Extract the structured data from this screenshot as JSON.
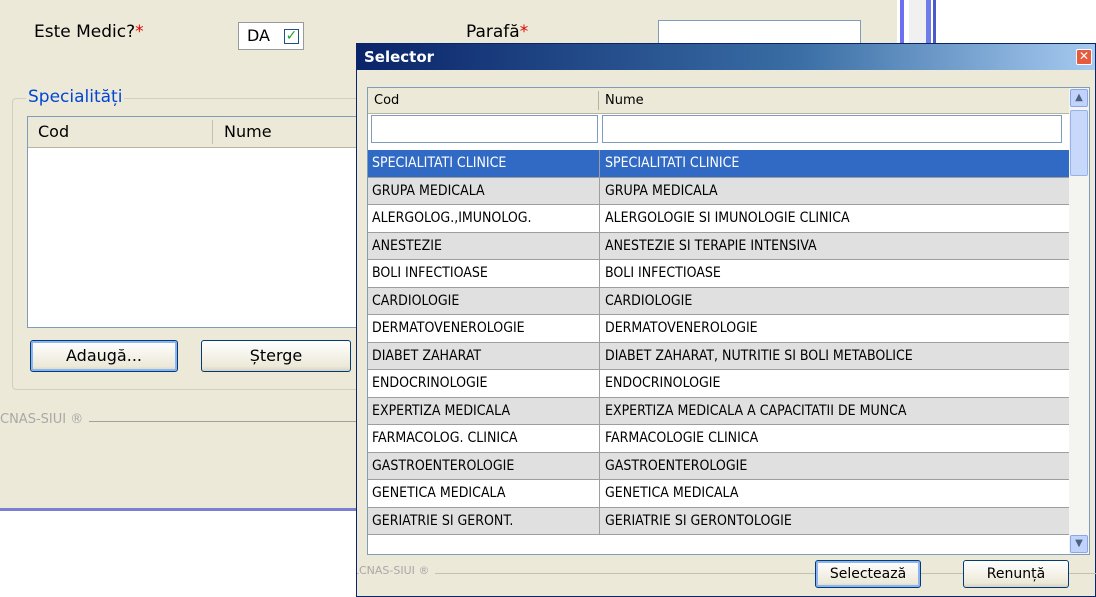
{
  "form": {
    "este_medic_label": "Este Medic?",
    "required_mark": "*",
    "da_value": "DA",
    "da_checked": true,
    "parafa_label": "Parafă",
    "parafa_value": "",
    "specialitati_legend": "Specialități",
    "spec_columns": [
      "Cod",
      "Nume"
    ],
    "add_label": "Adaugă...",
    "delete_label": "Șterge",
    "footer": "CNAS-SIUI ®"
  },
  "dialog": {
    "title": "Selector",
    "columns": [
      "Cod",
      "Nume"
    ],
    "filter_cod": "",
    "filter_nume": "",
    "rows": [
      {
        "cod": "SPECIALITATI CLINICE",
        "nume": "SPECIALITATI CLINICE",
        "selected": true
      },
      {
        "cod": "GRUPA MEDICALA",
        "nume": "GRUPA MEDICALA"
      },
      {
        "cod": "ALERGOLOG.,IMUNOLOG.",
        "nume": "ALERGOLOGIE SI IMUNOLOGIE CLINICA"
      },
      {
        "cod": "ANESTEZIE",
        "nume": "ANESTEZIE SI TERAPIE INTENSIVA"
      },
      {
        "cod": "BOLI INFECTIOASE",
        "nume": "BOLI INFECTIOASE"
      },
      {
        "cod": "CARDIOLOGIE",
        "nume": "CARDIOLOGIE"
      },
      {
        "cod": "DERMATOVENEROLOGIE",
        "nume": "DERMATOVENEROLOGIE"
      },
      {
        "cod": "DIABET ZAHARAT",
        "nume": "DIABET ZAHARAT, NUTRITIE SI BOLI METABOLICE"
      },
      {
        "cod": "ENDOCRINOLOGIE",
        "nume": "ENDOCRINOLOGIE"
      },
      {
        "cod": "EXPERTIZA MEDICALA",
        "nume": "EXPERTIZA MEDICALA A CAPACITATII DE MUNCA"
      },
      {
        "cod": "FARMACOLOG. CLINICA",
        "nume": "FARMACOLOGIE CLINICA"
      },
      {
        "cod": "GASTROENTEROLOGIE",
        "nume": "GASTROENTEROLOGIE"
      },
      {
        "cod": "GENETICA MEDICALA",
        "nume": "GENETICA MEDICALA"
      },
      {
        "cod": "GERIATRIE SI GERONT.",
        "nume": "GERIATRIE SI GERONTOLOGIE"
      }
    ],
    "footer": "CNAS-SIUI ®",
    "select_label": "Selectează",
    "cancel_label": "Renunță"
  },
  "icons": {
    "close": "close-icon",
    "check": "checkmark-icon",
    "scroll_up": "arrow-up-icon",
    "scroll_down": "arrow-down-icon"
  },
  "colors": {
    "selection": "#316ac5",
    "required": "#e00000",
    "legend": "#0046d5",
    "title_bar": "#0a246a"
  }
}
